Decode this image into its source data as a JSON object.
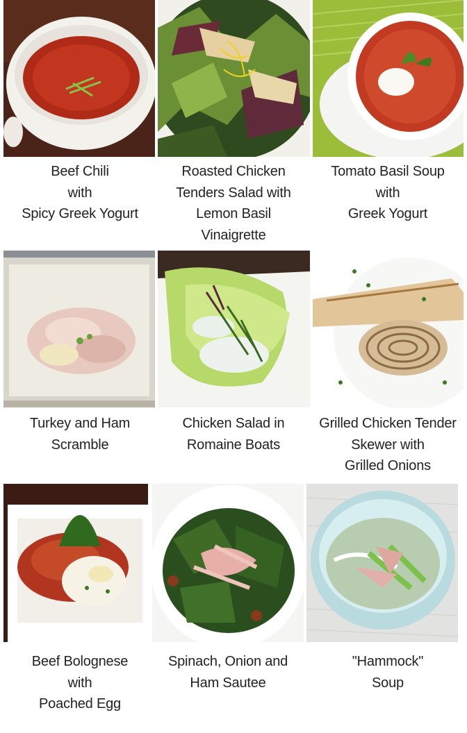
{
  "grid": {
    "items": [
      {
        "name": "beef-chili",
        "caption": [
          "Beef Chili",
          "with",
          "Spicy Greek Yogurt"
        ],
        "photo": "bowl of red beef chili topped with green onion"
      },
      {
        "name": "roasted-chicken-salad",
        "caption": [
          "Roasted Chicken",
          "Tenders Salad with",
          "Lemon Basil",
          "Vinaigrette"
        ],
        "photo": "mixed greens with chicken and lemon zest"
      },
      {
        "name": "tomato-basil-soup",
        "caption": [
          "Tomato Basil Soup",
          "with",
          "Greek Yogurt"
        ],
        "photo": "tomato soup with yogurt and basil on green mat"
      },
      {
        "name": "turkey-ham-scramble",
        "caption": [
          "Turkey and Ham",
          "Scramble"
        ],
        "photo": "chopped turkey and ham on white tray"
      },
      {
        "name": "chicken-salad-romaine",
        "caption": [
          "Chicken Salad in",
          "Romaine Boats"
        ],
        "photo": "romaine leaves filled with chicken salad"
      },
      {
        "name": "grilled-chicken-skewer",
        "caption": [
          "Grilled Chicken Tender",
          "Skewer with",
          "Grilled Onions"
        ],
        "photo": "grilled chicken tenders with grilled onion rings"
      },
      {
        "name": "beef-bolognese",
        "caption": [
          "Beef Bolognese",
          "with",
          "Poached Egg"
        ],
        "photo": "bolognese with poached egg and basil in white dish"
      },
      {
        "name": "spinach-onion-ham",
        "caption": [
          "Spinach, Onion and",
          "Ham Sautee"
        ],
        "photo": "sauteed spinach with onion and ham on plate"
      },
      {
        "name": "hammock-soup",
        "caption": [
          "\"Hammock\"",
          "Soup"
        ],
        "photo": "clear soup with ham and green beans in bowl"
      }
    ]
  }
}
